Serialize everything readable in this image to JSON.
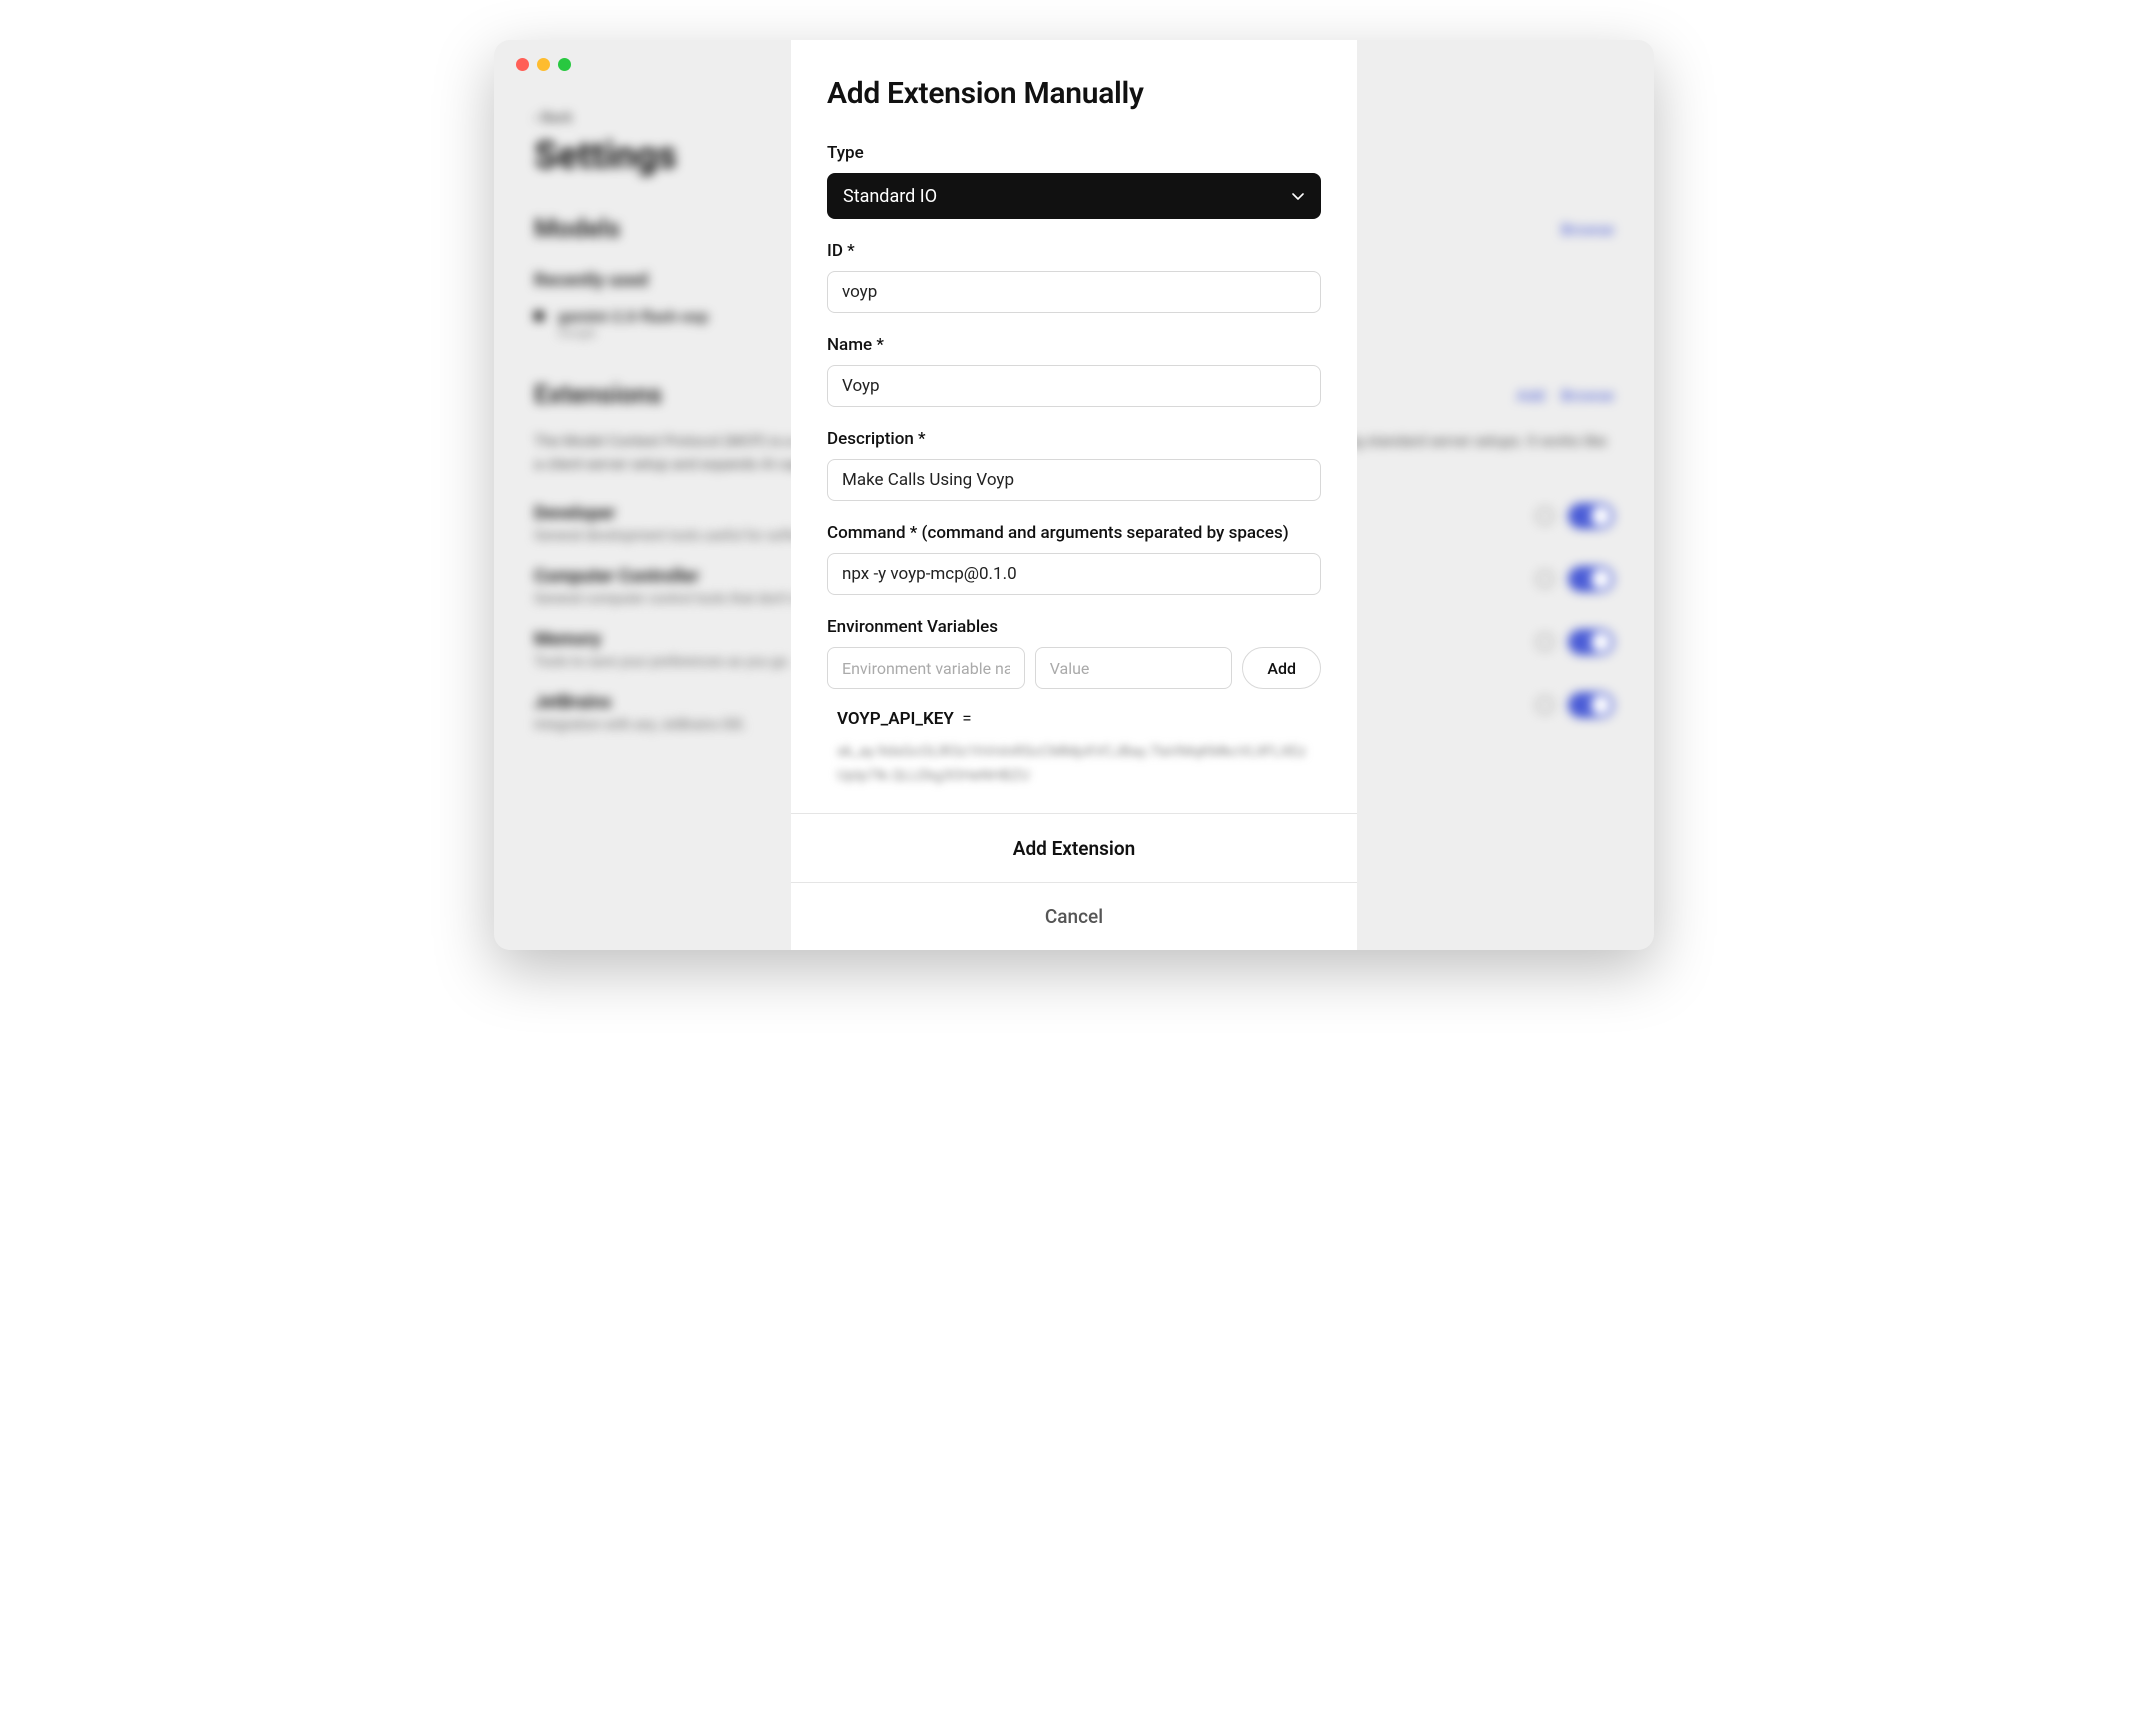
{
  "background": {
    "back": "‹ Back",
    "settings_title": "Settings",
    "models_title": "Models",
    "browse": "Browse",
    "recently_used": "Recently used",
    "model_name": "gemini-2.0-flash-exp",
    "model_sub": "Google",
    "extensions_title": "Extensions",
    "add": "Add",
    "extensions_desc": "The Model Context Protocol (MCP) is a system that lets AI models securely connect with various software applications using standard server setups. It works like a client-server setup and expands AI capabilities using three main types of support: Resources, Prompts, and Tools.",
    "items": [
      {
        "name": "Developer",
        "desc": "General development tools useful for software engineering."
      },
      {
        "name": "Computer Controller",
        "desc": "General computer control tools that don't require internet."
      },
      {
        "name": "Memory",
        "desc": "Tools to save your preferences as you go."
      },
      {
        "name": "JetBrains",
        "desc": "Integration with any JetBrains IDE."
      }
    ]
  },
  "modal": {
    "title": "Add Extension Manually",
    "type_label": "Type",
    "type_value": "Standard IO",
    "id_label": "ID *",
    "id_value": "voyp",
    "name_label": "Name *",
    "name_value": "Voyp",
    "description_label": "Description *",
    "description_value": "Make Calls Using Voyp",
    "command_label": "Command * (command and arguments separated by spaces)",
    "command_value": "npx -y voyp-mcp@0.1.0",
    "env_label": "Environment Variables",
    "env_name_placeholder": "Environment variable name",
    "env_value_placeholder": "Value",
    "env_add": "Add",
    "env_var": {
      "key": "VOYP_API_KEY",
      "equals": "=",
      "value": "sk_ay.9dsGcOLlR3z1hVnInRScCMMpXVCJBay.7laVMqKMkcVLIIFLXEzUpIp7Ik.QLLEkg3OHeNHBZU"
    },
    "add_extension": "Add Extension",
    "cancel": "Cancel"
  }
}
